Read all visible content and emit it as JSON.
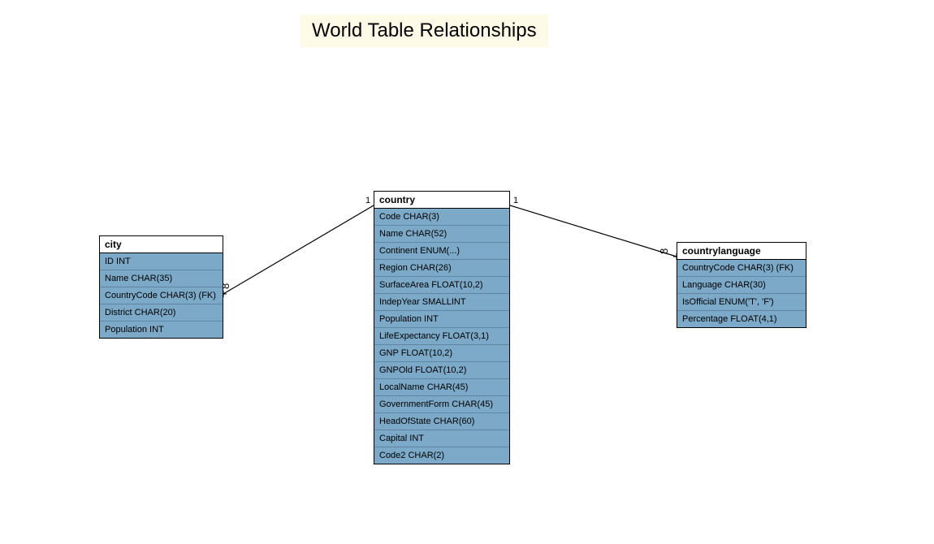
{
  "title": "World Table Relationships",
  "entities": {
    "city": {
      "name": "city",
      "columns": [
        "ID INT",
        "Name CHAR(35)",
        "CountryCode CHAR(3) (FK)",
        "District CHAR(20)",
        "Population INT"
      ]
    },
    "country": {
      "name": "country",
      "columns": [
        "Code CHAR(3)",
        "Name CHAR(52)",
        "Continent ENUM(...)",
        "Region CHAR(26)",
        "SurfaceArea FLOAT(10,2)",
        "IndepYear SMALLINT",
        "Population INT",
        "LifeExpectancy FLOAT(3,1)",
        "GNP FLOAT(10,2)",
        "GNPOld FLOAT(10,2)",
        "LocalName CHAR(45)",
        "GovernmentForm CHAR(45)",
        "HeadOfState CHAR(60)",
        "Capital INT",
        "Code2 CHAR(2)"
      ]
    },
    "countrylanguage": {
      "name": "countrylanguage",
      "columns": [
        "CountryCode CHAR(3) (FK)",
        "Language CHAR(30)",
        "IsOfficial ENUM('T', 'F')",
        "Percentage FLOAT(4,1)"
      ]
    }
  },
  "cardinality": {
    "one_left": "1",
    "one_right": "1",
    "many_left": "∞",
    "many_right": "∞"
  }
}
